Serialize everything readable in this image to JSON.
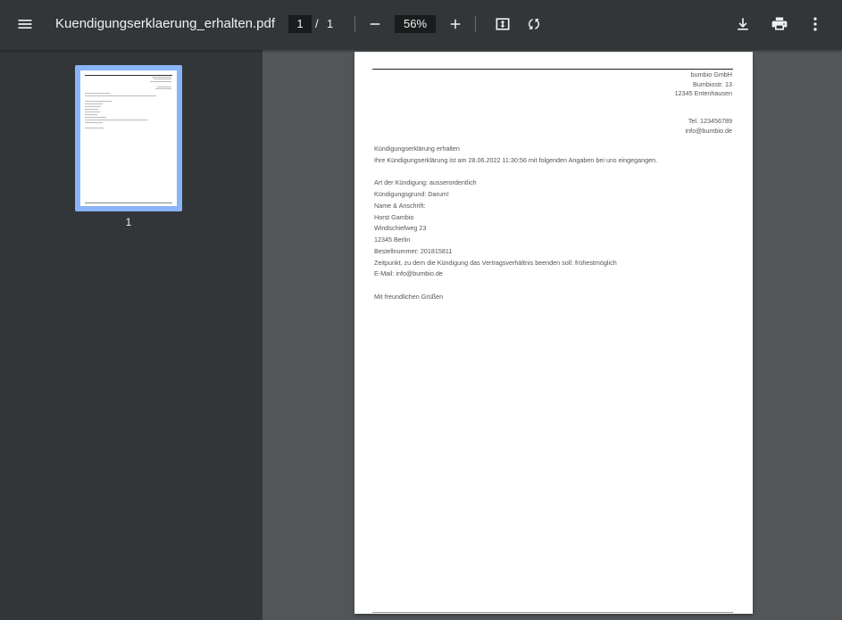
{
  "toolbar": {
    "title": "Kuendigungserklaerung_erhalten.pdf",
    "current_page": "1",
    "page_separator": "/",
    "total_pages": "1",
    "zoom": "56%"
  },
  "icons": [
    "menu-icon",
    "minus-icon",
    "plus-icon",
    "fit-page-icon",
    "rotate-icon",
    "download-icon",
    "print-icon",
    "more-vert-icon"
  ],
  "sidebar": {
    "thumbnails": [
      {
        "label": "1"
      }
    ]
  },
  "document": {
    "sender": {
      "company": "bumbio GmbH",
      "street": "Bumbiostr. 13",
      "city": "12345 Entenhausen",
      "phone": "Tel. 123456789",
      "email": "info@bumbio.de"
    },
    "lines": [
      "Kündigungserklärung erhalten",
      "Ihre Kündigungserklärung ist am 28.06.2022 11:30:56 mit folgenden Angaben bei uns eingegangen.",
      "",
      "Art der Kündigung: ausserordentlich",
      "Kündigungsgrund: Darum!",
      "Name & Anschrift:",
      "Horst Gambio",
      "Windschiefweg 23",
      "12345 Berlin",
      "Bestellnummer: 201815811",
      "Zeitpunkt, zu dem die Kündigung das Vertragsverhältnis beenden soll: frühestmöglich",
      "E-Mail: info@bumbio.de",
      "",
      "Mit freundlichen Grüßen"
    ]
  },
  "colors": {
    "toolbar_bg": "#323639",
    "viewer_bg": "#525659",
    "thumb_selected": "#8ab4f8"
  }
}
